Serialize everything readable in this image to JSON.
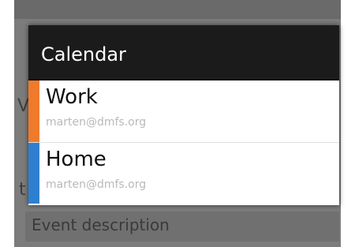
{
  "background": {
    "partial_letters": [
      "V",
      "t"
    ],
    "description_placeholder": "Event description"
  },
  "dialog": {
    "title": "Calendar",
    "items": [
      {
        "name": "Work",
        "account": "marten@dmfs.org",
        "color": "#f07a2c"
      },
      {
        "name": "Home",
        "account": "marten@dmfs.org",
        "color": "#2f7fd0"
      }
    ]
  }
}
